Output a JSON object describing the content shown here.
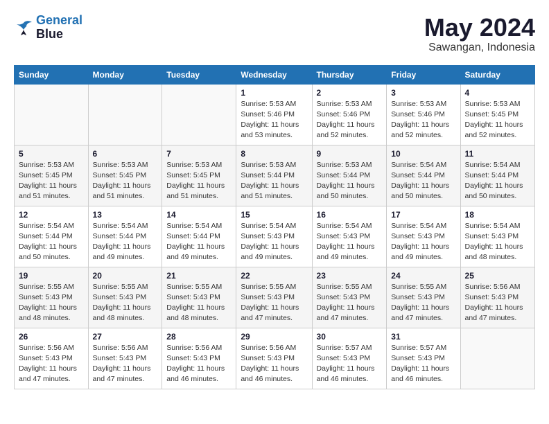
{
  "logo": {
    "line1": "General",
    "line2": "Blue"
  },
  "title": "May 2024",
  "subtitle": "Sawangan, Indonesia",
  "days_header": [
    "Sunday",
    "Monday",
    "Tuesday",
    "Wednesday",
    "Thursday",
    "Friday",
    "Saturday"
  ],
  "weeks": [
    [
      {
        "num": "",
        "info": ""
      },
      {
        "num": "",
        "info": ""
      },
      {
        "num": "",
        "info": ""
      },
      {
        "num": "1",
        "info": "Sunrise: 5:53 AM\nSunset: 5:46 PM\nDaylight: 11 hours\nand 53 minutes."
      },
      {
        "num": "2",
        "info": "Sunrise: 5:53 AM\nSunset: 5:46 PM\nDaylight: 11 hours\nand 52 minutes."
      },
      {
        "num": "3",
        "info": "Sunrise: 5:53 AM\nSunset: 5:46 PM\nDaylight: 11 hours\nand 52 minutes."
      },
      {
        "num": "4",
        "info": "Sunrise: 5:53 AM\nSunset: 5:45 PM\nDaylight: 11 hours\nand 52 minutes."
      }
    ],
    [
      {
        "num": "5",
        "info": "Sunrise: 5:53 AM\nSunset: 5:45 PM\nDaylight: 11 hours\nand 51 minutes."
      },
      {
        "num": "6",
        "info": "Sunrise: 5:53 AM\nSunset: 5:45 PM\nDaylight: 11 hours\nand 51 minutes."
      },
      {
        "num": "7",
        "info": "Sunrise: 5:53 AM\nSunset: 5:45 PM\nDaylight: 11 hours\nand 51 minutes."
      },
      {
        "num": "8",
        "info": "Sunrise: 5:53 AM\nSunset: 5:44 PM\nDaylight: 11 hours\nand 51 minutes."
      },
      {
        "num": "9",
        "info": "Sunrise: 5:53 AM\nSunset: 5:44 PM\nDaylight: 11 hours\nand 50 minutes."
      },
      {
        "num": "10",
        "info": "Sunrise: 5:54 AM\nSunset: 5:44 PM\nDaylight: 11 hours\nand 50 minutes."
      },
      {
        "num": "11",
        "info": "Sunrise: 5:54 AM\nSunset: 5:44 PM\nDaylight: 11 hours\nand 50 minutes."
      }
    ],
    [
      {
        "num": "12",
        "info": "Sunrise: 5:54 AM\nSunset: 5:44 PM\nDaylight: 11 hours\nand 50 minutes."
      },
      {
        "num": "13",
        "info": "Sunrise: 5:54 AM\nSunset: 5:44 PM\nDaylight: 11 hours\nand 49 minutes."
      },
      {
        "num": "14",
        "info": "Sunrise: 5:54 AM\nSunset: 5:44 PM\nDaylight: 11 hours\nand 49 minutes."
      },
      {
        "num": "15",
        "info": "Sunrise: 5:54 AM\nSunset: 5:43 PM\nDaylight: 11 hours\nand 49 minutes."
      },
      {
        "num": "16",
        "info": "Sunrise: 5:54 AM\nSunset: 5:43 PM\nDaylight: 11 hours\nand 49 minutes."
      },
      {
        "num": "17",
        "info": "Sunrise: 5:54 AM\nSunset: 5:43 PM\nDaylight: 11 hours\nand 49 minutes."
      },
      {
        "num": "18",
        "info": "Sunrise: 5:54 AM\nSunset: 5:43 PM\nDaylight: 11 hours\nand 48 minutes."
      }
    ],
    [
      {
        "num": "19",
        "info": "Sunrise: 5:55 AM\nSunset: 5:43 PM\nDaylight: 11 hours\nand 48 minutes."
      },
      {
        "num": "20",
        "info": "Sunrise: 5:55 AM\nSunset: 5:43 PM\nDaylight: 11 hours\nand 48 minutes."
      },
      {
        "num": "21",
        "info": "Sunrise: 5:55 AM\nSunset: 5:43 PM\nDaylight: 11 hours\nand 48 minutes."
      },
      {
        "num": "22",
        "info": "Sunrise: 5:55 AM\nSunset: 5:43 PM\nDaylight: 11 hours\nand 47 minutes."
      },
      {
        "num": "23",
        "info": "Sunrise: 5:55 AM\nSunset: 5:43 PM\nDaylight: 11 hours\nand 47 minutes."
      },
      {
        "num": "24",
        "info": "Sunrise: 5:55 AM\nSunset: 5:43 PM\nDaylight: 11 hours\nand 47 minutes."
      },
      {
        "num": "25",
        "info": "Sunrise: 5:56 AM\nSunset: 5:43 PM\nDaylight: 11 hours\nand 47 minutes."
      }
    ],
    [
      {
        "num": "26",
        "info": "Sunrise: 5:56 AM\nSunset: 5:43 PM\nDaylight: 11 hours\nand 47 minutes."
      },
      {
        "num": "27",
        "info": "Sunrise: 5:56 AM\nSunset: 5:43 PM\nDaylight: 11 hours\nand 47 minutes."
      },
      {
        "num": "28",
        "info": "Sunrise: 5:56 AM\nSunset: 5:43 PM\nDaylight: 11 hours\nand 46 minutes."
      },
      {
        "num": "29",
        "info": "Sunrise: 5:56 AM\nSunset: 5:43 PM\nDaylight: 11 hours\nand 46 minutes."
      },
      {
        "num": "30",
        "info": "Sunrise: 5:57 AM\nSunset: 5:43 PM\nDaylight: 11 hours\nand 46 minutes."
      },
      {
        "num": "31",
        "info": "Sunrise: 5:57 AM\nSunset: 5:43 PM\nDaylight: 11 hours\nand 46 minutes."
      },
      {
        "num": "",
        "info": ""
      }
    ]
  ]
}
